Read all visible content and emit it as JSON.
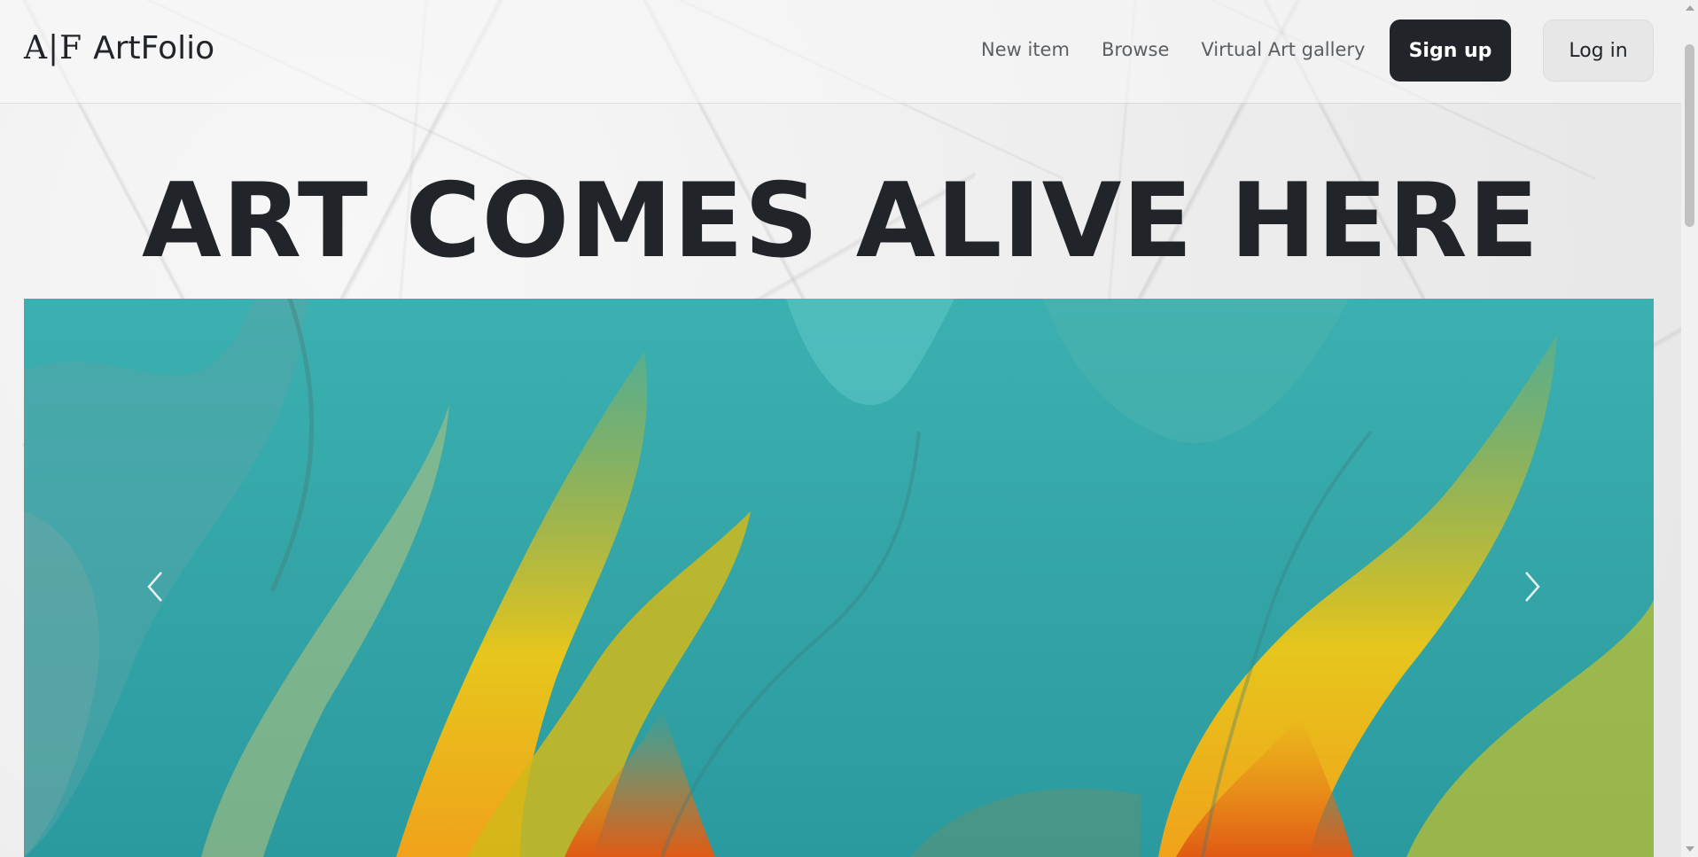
{
  "brand": {
    "mark": "A|F",
    "name": "ArtFolio"
  },
  "nav": {
    "links": [
      {
        "label": "New item"
      },
      {
        "label": "Browse"
      },
      {
        "label": "Virtual Art gallery"
      }
    ],
    "signup_label": "Sign up",
    "login_label": "Log in"
  },
  "hero": {
    "title": "ART COMES ALIVE HERE"
  },
  "carousel": {
    "prev_icon": "chevron-left-icon",
    "next_icon": "chevron-right-icon"
  },
  "colors": {
    "primary_dark": "#212529",
    "nav_link": "#5a5f64",
    "login_bg": "#e7e7e7",
    "art_teal": "#2fa3a6",
    "art_yellow": "#e3c21a",
    "art_orange": "#e8701c"
  }
}
